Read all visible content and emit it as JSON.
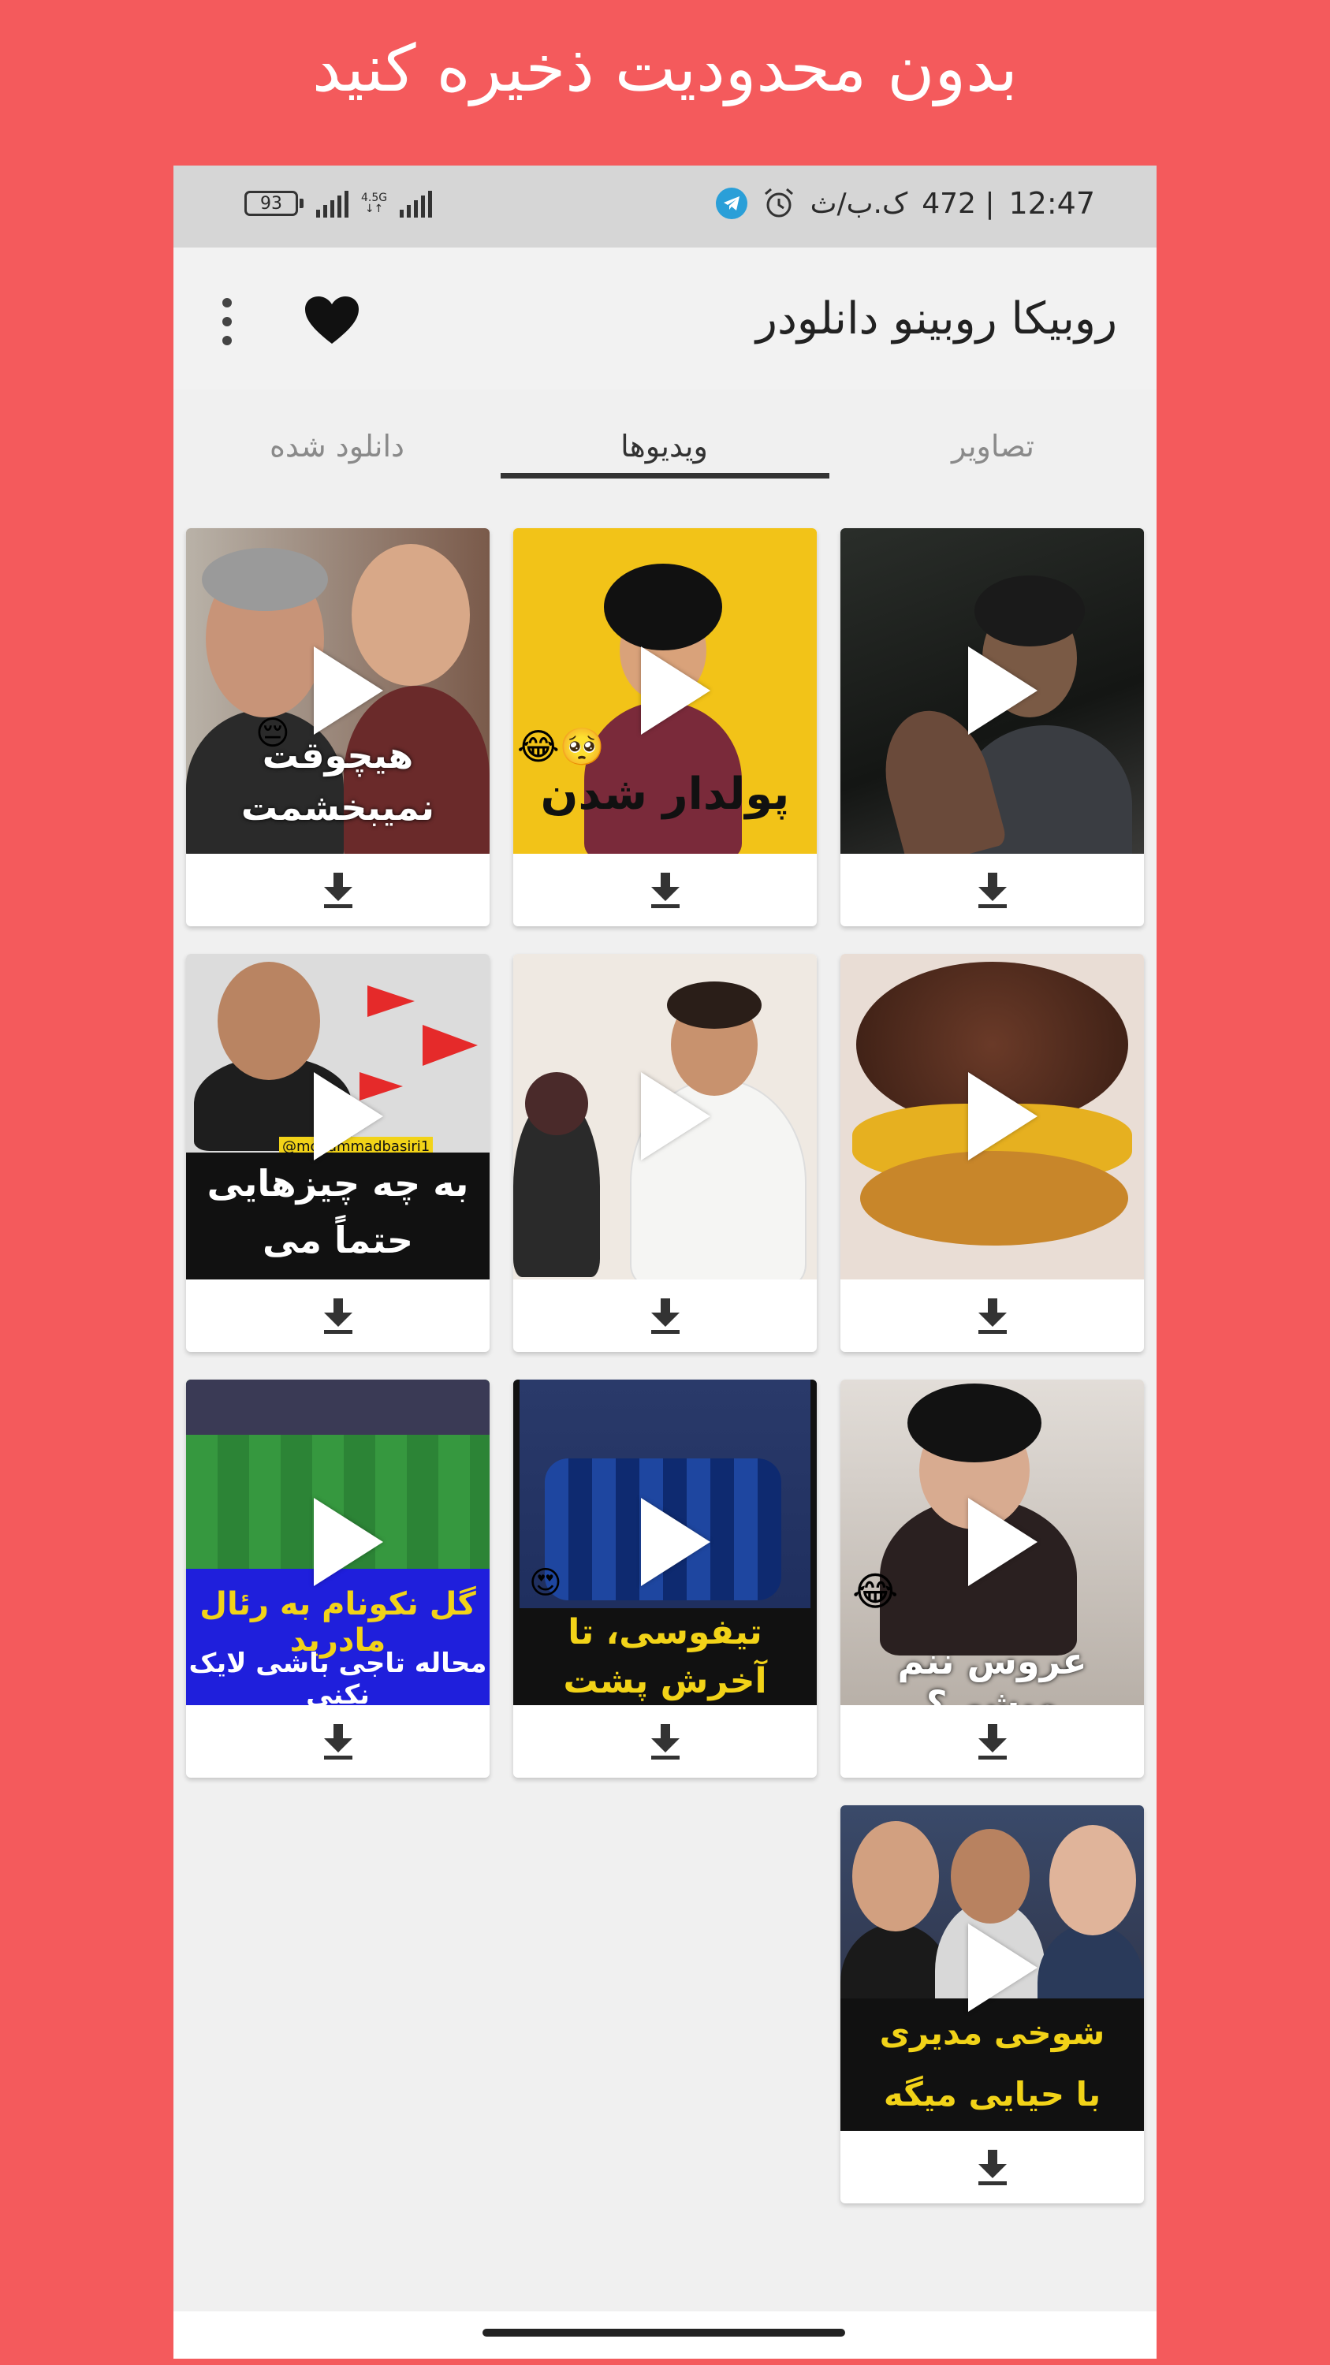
{
  "promo": {
    "title": "بدون محدودیت ذخیره کنید"
  },
  "statusbar": {
    "time": "12:47",
    "data_rate": "472 | ",
    "data_unit": "ک.ب/ث",
    "battery": "93",
    "network": "4.5G"
  },
  "appbar": {
    "title": "روبیکا روبینو دانلودر",
    "favorites_icon": "heart-icon",
    "menu_icon": "more-vert-icon"
  },
  "tabs": [
    {
      "label": "تصاویر"
    },
    {
      "label": "ویدیوها",
      "active": true
    },
    {
      "label": "دانلود شده"
    }
  ],
  "videos": [
    {
      "caption": "",
      "emoji": ""
    },
    {
      "caption": "پولدار شدن",
      "emoji": "😂🥺"
    },
    {
      "caption": "هیچوقت نمیبخشمت",
      "emoji": "😔"
    },
    {
      "caption": "",
      "emoji": ""
    },
    {
      "caption": "",
      "emoji": ""
    },
    {
      "caption": "به چه چیزهایی حتماً می رسی؟!",
      "handle": "@mohammadbasiri1"
    },
    {
      "caption": "عروس ننم میشی؟",
      "emoji": "😂"
    },
    {
      "caption": "تیفوسی، تا آخرش پشت تیمش هست!",
      "emoji": "😍"
    },
    {
      "caption": "گل نکونام به رئال مادرید",
      "subcaption": "محاله تاجی باشی لایک نکنی"
    },
    {
      "caption": "شوخی مدیری با حیایی میگه دلم خواست",
      "emoji": ""
    }
  ],
  "icons": {
    "play": "play-icon",
    "download": "download-icon"
  },
  "colors": {
    "background": "#f45a5c",
    "accent": "#333333"
  }
}
